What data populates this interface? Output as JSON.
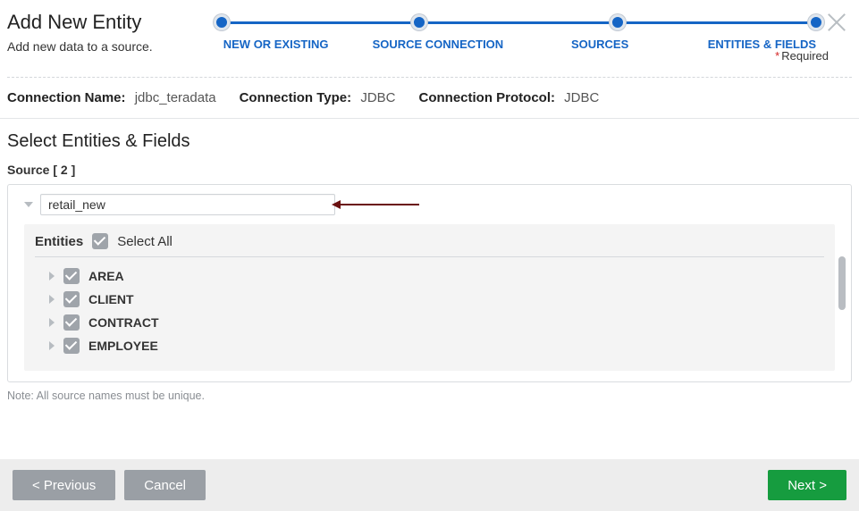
{
  "header": {
    "title": "Add New Entity",
    "subtitle": "Add new data to a source.",
    "required_label": "Required"
  },
  "stepper": {
    "steps": [
      {
        "label": "NEW OR EXISTING"
      },
      {
        "label": "SOURCE CONNECTION"
      },
      {
        "label": "SOURCES"
      },
      {
        "label": "ENTITIES & FIELDS"
      }
    ]
  },
  "connection": {
    "name_label": "Connection Name:",
    "name_value": "jdbc_teradata",
    "type_label": "Connection Type:",
    "type_value": "JDBC",
    "protocol_label": "Connection Protocol:",
    "protocol_value": "JDBC"
  },
  "section": {
    "title": "Select Entities & Fields",
    "source_count_label": "Source [ 2 ]",
    "source_value": "retail_new"
  },
  "entities": {
    "header": "Entities",
    "select_all": "Select All",
    "items": [
      {
        "name": "AREA"
      },
      {
        "name": "CLIENT"
      },
      {
        "name": "CONTRACT"
      },
      {
        "name": "EMPLOYEE"
      }
    ]
  },
  "note": "Note: All source names must be unique.",
  "footer": {
    "previous": "< Previous",
    "cancel": "Cancel",
    "next": "Next >"
  }
}
